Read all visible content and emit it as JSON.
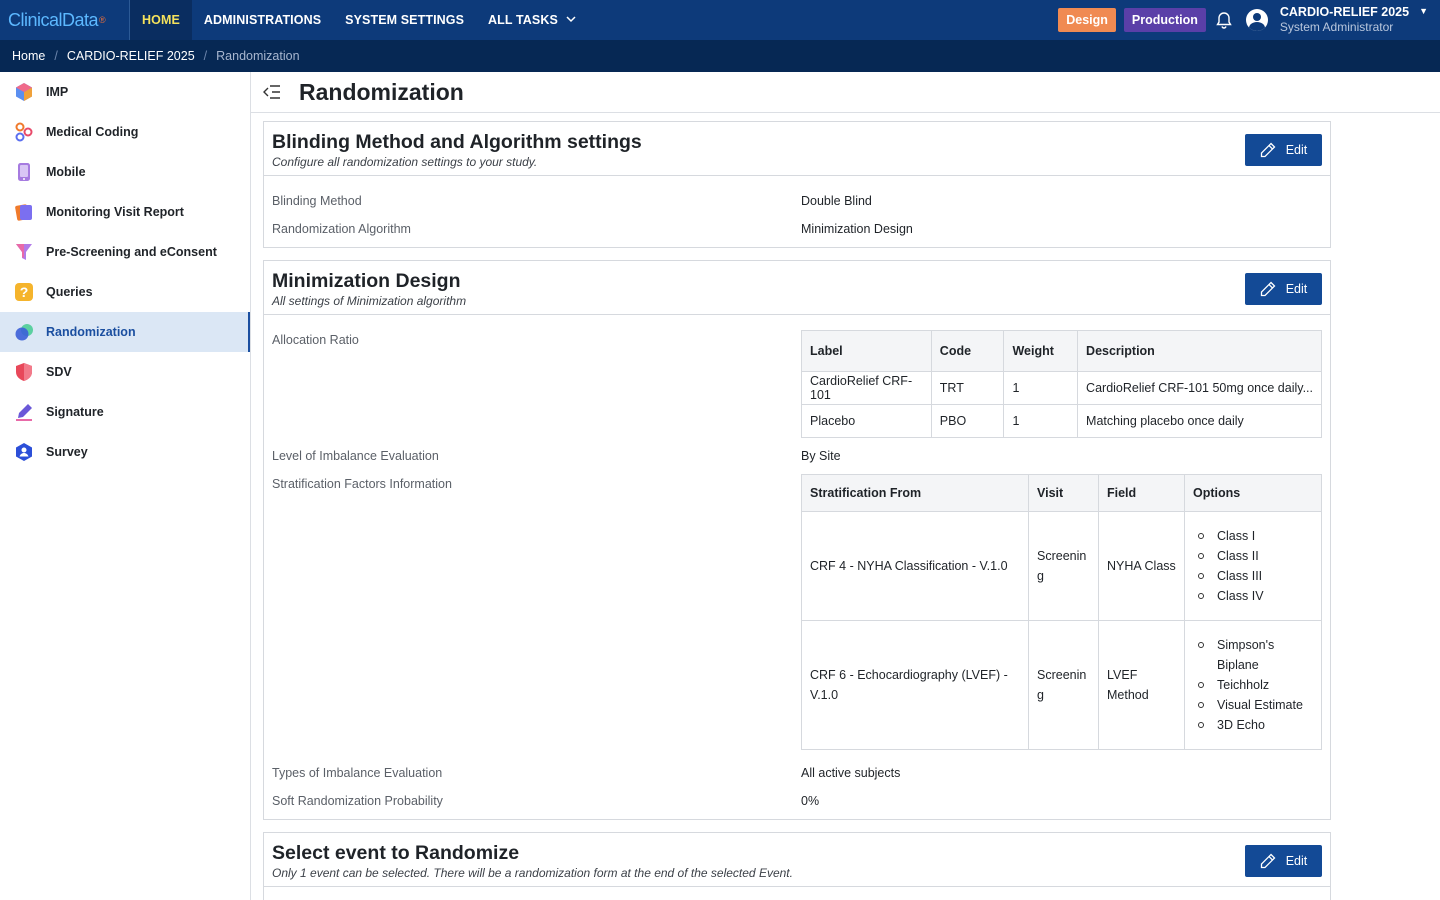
{
  "topbar": {
    "logo_text": "ClinicalData",
    "logo_mark": "®",
    "nav": [
      "HOME",
      "ADMINISTRATIONS",
      "SYSTEM SETTINGS",
      "ALL TASKS"
    ],
    "design_badge": "Design",
    "production_badge": "Production",
    "user_name": "CARDIO-RELIEF 2025",
    "user_role": "System Administrator"
  },
  "breadcrumb": {
    "home": "Home",
    "study": "CARDIO-RELIEF 2025",
    "current": "Randomization"
  },
  "sidebar": {
    "items": [
      {
        "label": "IMP",
        "icon": "cube-icon"
      },
      {
        "label": "Medical Coding",
        "icon": "molecule-icon"
      },
      {
        "label": "Mobile",
        "icon": "phone-icon"
      },
      {
        "label": "Monitoring Visit Report",
        "icon": "report-icon"
      },
      {
        "label": "Pre-Screening and eConsent",
        "icon": "funnel-icon"
      },
      {
        "label": "Queries",
        "icon": "question-icon"
      },
      {
        "label": "Randomization",
        "icon": "randomization-icon"
      },
      {
        "label": "SDV",
        "icon": "shield-icon"
      },
      {
        "label": "Signature",
        "icon": "pen-icon"
      },
      {
        "label": "Survey",
        "icon": "survey-icon"
      }
    ],
    "active": "Randomization"
  },
  "page": {
    "title": "Randomization"
  },
  "blinding": {
    "title": "Blinding Method and Algorithm settings",
    "subtitle": "Configure all randomization settings to your study.",
    "edit": "Edit",
    "rows": [
      {
        "label": "Blinding Method",
        "value": "Double Blind"
      },
      {
        "label": "Randomization Algorithm",
        "value": "Minimization Design"
      }
    ]
  },
  "minimization": {
    "title": "Minimization Design",
    "subtitle": "All settings of Minimization algorithm",
    "edit": "Edit",
    "allocation_label": "Allocation Ratio",
    "allocation_headers": [
      "Label",
      "Code",
      "Weight",
      "Description"
    ],
    "allocation_rows": [
      [
        "CardioRelief CRF-101",
        "TRT",
        "1",
        "CardioRelief CRF-101 50mg once daily..."
      ],
      [
        "Placebo",
        "PBO",
        "1",
        "Matching placebo once daily"
      ]
    ],
    "imbalance_level_label": "Level of Imbalance Evaluation",
    "imbalance_level_value": "By Site",
    "strat_label": "Stratification Factors Information",
    "strat_headers": [
      "Stratification From",
      "Visit",
      "Field",
      "Options"
    ],
    "strat_rows": [
      {
        "from": "CRF 4 - NYHA Classification - V.1.0",
        "visit": "Screenin g",
        "field": "NYHA Class",
        "options": [
          "Class I",
          "Class II",
          "Class III",
          "Class IV"
        ]
      },
      {
        "from": "CRF 6 - Echocardiography (LVEF) - V.1.0",
        "visit": "Screenin g",
        "field": "LVEF Method",
        "options": [
          "Simpson's Biplane",
          "Teichholz",
          "Visual Estimate",
          "3D Echo"
        ]
      }
    ],
    "types_label": "Types of Imbalance Evaluation",
    "types_value": "All active subjects",
    "soft_label": "Soft Randomization Probability",
    "soft_value": "0%"
  },
  "select_event": {
    "title": "Select event to Randomize",
    "subtitle": "Only 1 event can be selected. There will be a randomization form at the end of the selected Event.",
    "edit": "Edit"
  },
  "colors": {
    "topbar": "#0d3a7a",
    "breadcrumb": "#062854",
    "accent": "#134a96",
    "design": "#f08a52",
    "production": "#5a3fa8",
    "active_nav": "#f5e25c"
  }
}
